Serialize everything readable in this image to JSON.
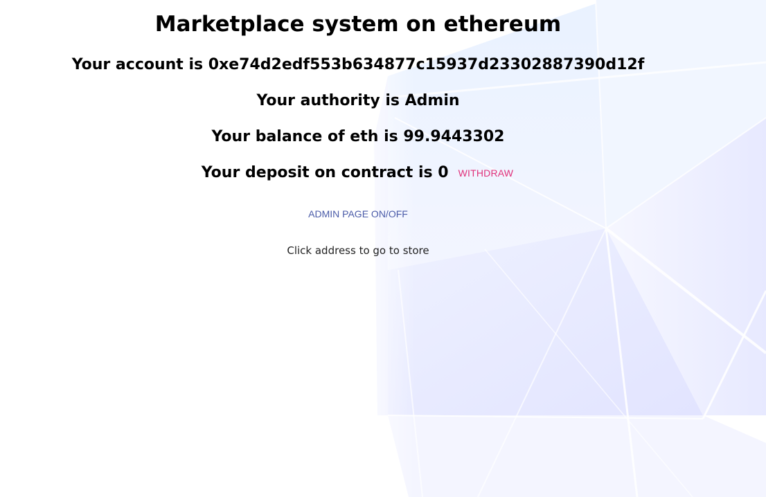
{
  "page": {
    "title": "Marketplace system on ethereum"
  },
  "account": {
    "label": "Your account is 0xe74d2edf553b634877c15937d23302887390d12f"
  },
  "authority": {
    "label": "Your authority is Admin"
  },
  "balance": {
    "label": "Your balance of eth is 99.9443302"
  },
  "deposit": {
    "label": "Your deposit on contract is 0",
    "withdraw_label": "WITHDRAW"
  },
  "admin": {
    "toggle_label": "ADMIN PAGE ON/OFF"
  },
  "store": {
    "hint": "Click address to go to store"
  },
  "colors": {
    "withdraw": "#e0307a",
    "admin_toggle": "#4a5ba8",
    "background_accent": "#e4e6ff"
  }
}
